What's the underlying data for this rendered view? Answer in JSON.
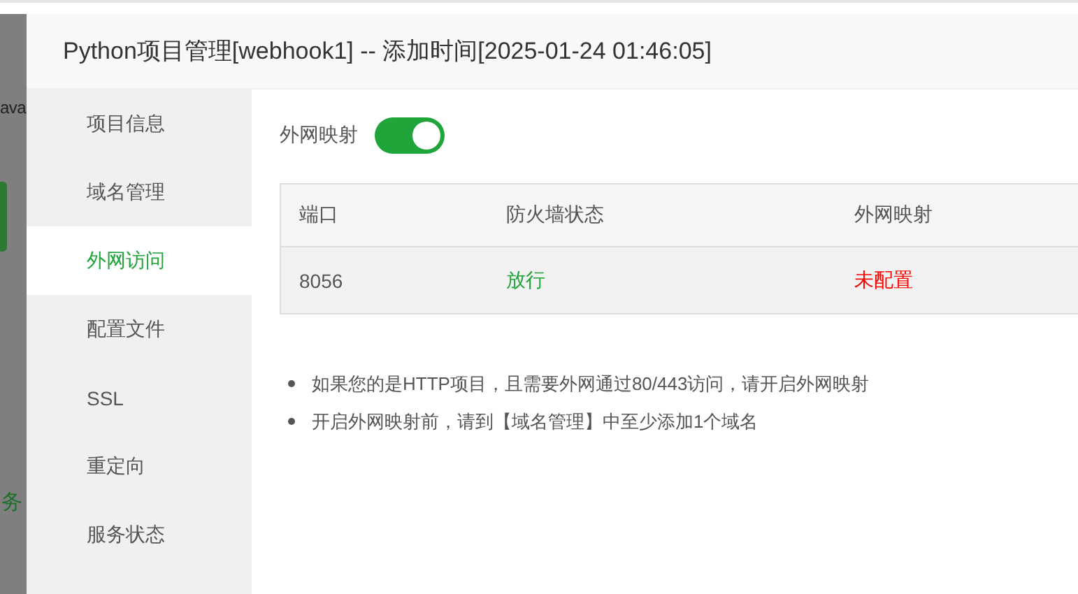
{
  "background": {
    "fragments": [
      {
        "text": "ava",
        "kind": "plain"
      },
      {
        "text": "务",
        "kind": "link"
      }
    ]
  },
  "window": {
    "title": "Python项目管理[webhook1] -- 添加时间[2025-01-24 01:46:05]"
  },
  "sidebar": {
    "items": [
      {
        "label": "项目信息",
        "selected": false
      },
      {
        "label": "域名管理",
        "selected": false
      },
      {
        "label": "外网访问",
        "selected": true
      },
      {
        "label": "配置文件",
        "selected": false
      },
      {
        "label": "SSL",
        "selected": false
      },
      {
        "label": "重定向",
        "selected": false
      },
      {
        "label": "服务状态",
        "selected": false
      }
    ]
  },
  "mapping_toggle": {
    "label": "外网映射",
    "on": true
  },
  "table": {
    "columns": [
      "端口",
      "防火墙状态",
      "外网映射"
    ],
    "rows": [
      [
        {
          "text": "8056",
          "kind": "plain"
        },
        {
          "text": "放行",
          "kind": "ok"
        },
        {
          "text": "未配置",
          "kind": "bad"
        }
      ]
    ]
  },
  "notes": [
    "如果您的是HTTP项目，且需要外网通过80/443访问，请开启外网映射",
    "开启外网映射前，请到【域名管理】中至少添加1个域名"
  ]
}
